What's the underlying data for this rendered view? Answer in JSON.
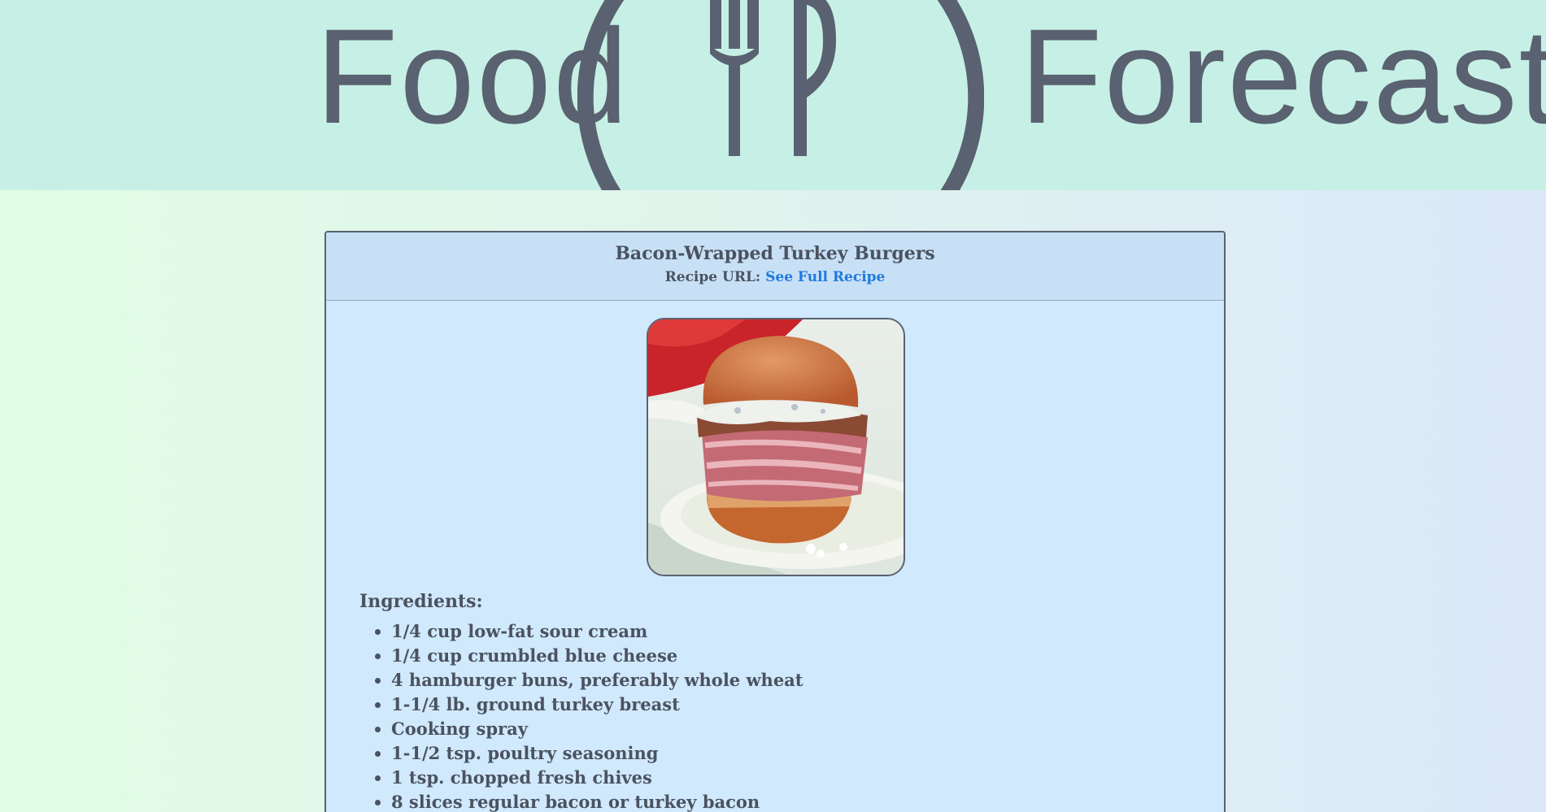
{
  "header": {
    "logo_left": "Food",
    "logo_right": "Forecaster",
    "logo_icon": "fork-and-spoon-plate-icon"
  },
  "recipe": {
    "title": "Bacon-Wrapped Turkey Burgers",
    "url_label": "Recipe URL:",
    "url_link_text": "See Full Recipe",
    "image_subject": "bacon-wrapped turkey burger on a plate",
    "ingredients_heading": "Ingredients:",
    "ingredients": [
      "1/4 cup low-fat sour cream",
      "1/4 cup crumbled blue cheese",
      "4 hamburger buns, preferably whole wheat",
      "1-1/4 lb. ground turkey breast",
      "Cooking spray",
      "1-1/2 tsp. poultry seasoning",
      "1 tsp. chopped fresh chives",
      "8 slices regular bacon or turkey bacon"
    ]
  },
  "colors": {
    "header_bg": "#c6f0e5",
    "logo": "#5a6170",
    "card_bg": "#d0e9fd",
    "link": "#1f7ae0",
    "text": "#4b5260"
  }
}
